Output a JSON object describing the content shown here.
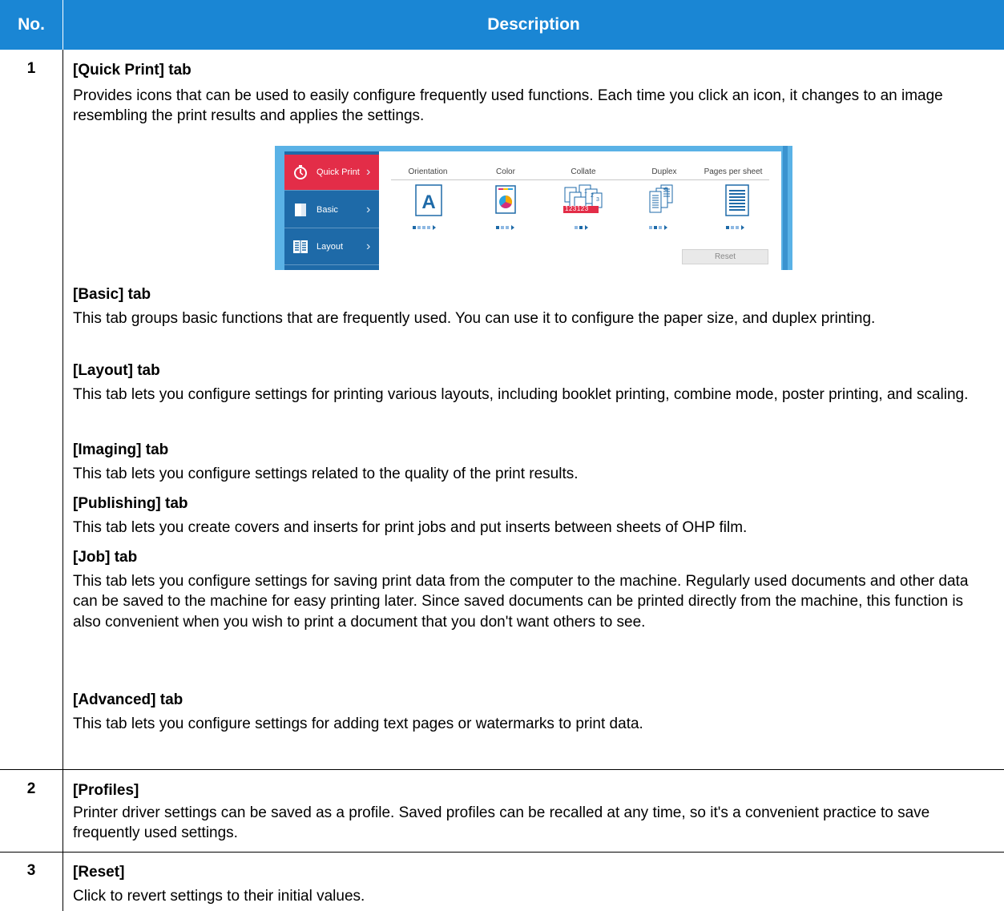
{
  "header": {
    "no": "No.",
    "description": "Description"
  },
  "rows": [
    {
      "no": "1",
      "sections": [
        {
          "heading": "[Quick Print] tab",
          "text": "Provides icons that can be used to easily configure frequently used functions. Each time you click an icon, it changes to an image resembling the print results and applies the settings."
        },
        {
          "heading": "[Basic] tab",
          "text": "This tab groups basic functions that are frequently used. You can use it to configure the paper size, and duplex printing."
        },
        {
          "heading": "[Layout] tab",
          "text": "This tab lets you configure settings for printing various layouts, including booklet printing, combine mode, poster printing, and scaling."
        },
        {
          "heading": "[Imaging] tab",
          "text": "This tab lets you configure settings related to the quality of the print results."
        },
        {
          "heading": "[Publishing] tab",
          "text": "This tab lets you create covers and inserts for print jobs and put inserts between sheets of OHP film."
        },
        {
          "heading": "[Job] tab",
          "text": "This tab lets you configure settings for saving print data from the computer to the machine. Regularly used documents and other data can be saved to the machine for easy printing later. Since saved documents can be printed directly from the machine, this function is also convenient when you wish to print a document that you don't want others to see."
        },
        {
          "heading": "[Advanced] tab",
          "text": "This tab lets you configure settings for adding text pages or watermarks to print data."
        }
      ]
    },
    {
      "no": "2",
      "sections": [
        {
          "heading": "[Profiles]",
          "text": "Printer driver settings can be saved as a profile. Saved profiles can be recalled at any time, so it's a convenient practice to save frequently used settings."
        }
      ]
    },
    {
      "no": "3",
      "sections": [
        {
          "heading": "[Reset]",
          "text": "Click to revert settings to their initial values."
        }
      ]
    }
  ],
  "screenshot": {
    "nav": [
      "Quick Print",
      "Basic",
      "Layout"
    ],
    "columns": [
      "Orientation",
      "Color",
      "Collate",
      "Duplex",
      "Pages per sheet"
    ],
    "collate_label": "123123",
    "reset_label": "Reset",
    "colors": {
      "nav_blue": "#1e6aa8",
      "active_red": "#e32d48",
      "frame_blue": "#5ab2e6",
      "header_blue": "#1a86d4"
    }
  }
}
